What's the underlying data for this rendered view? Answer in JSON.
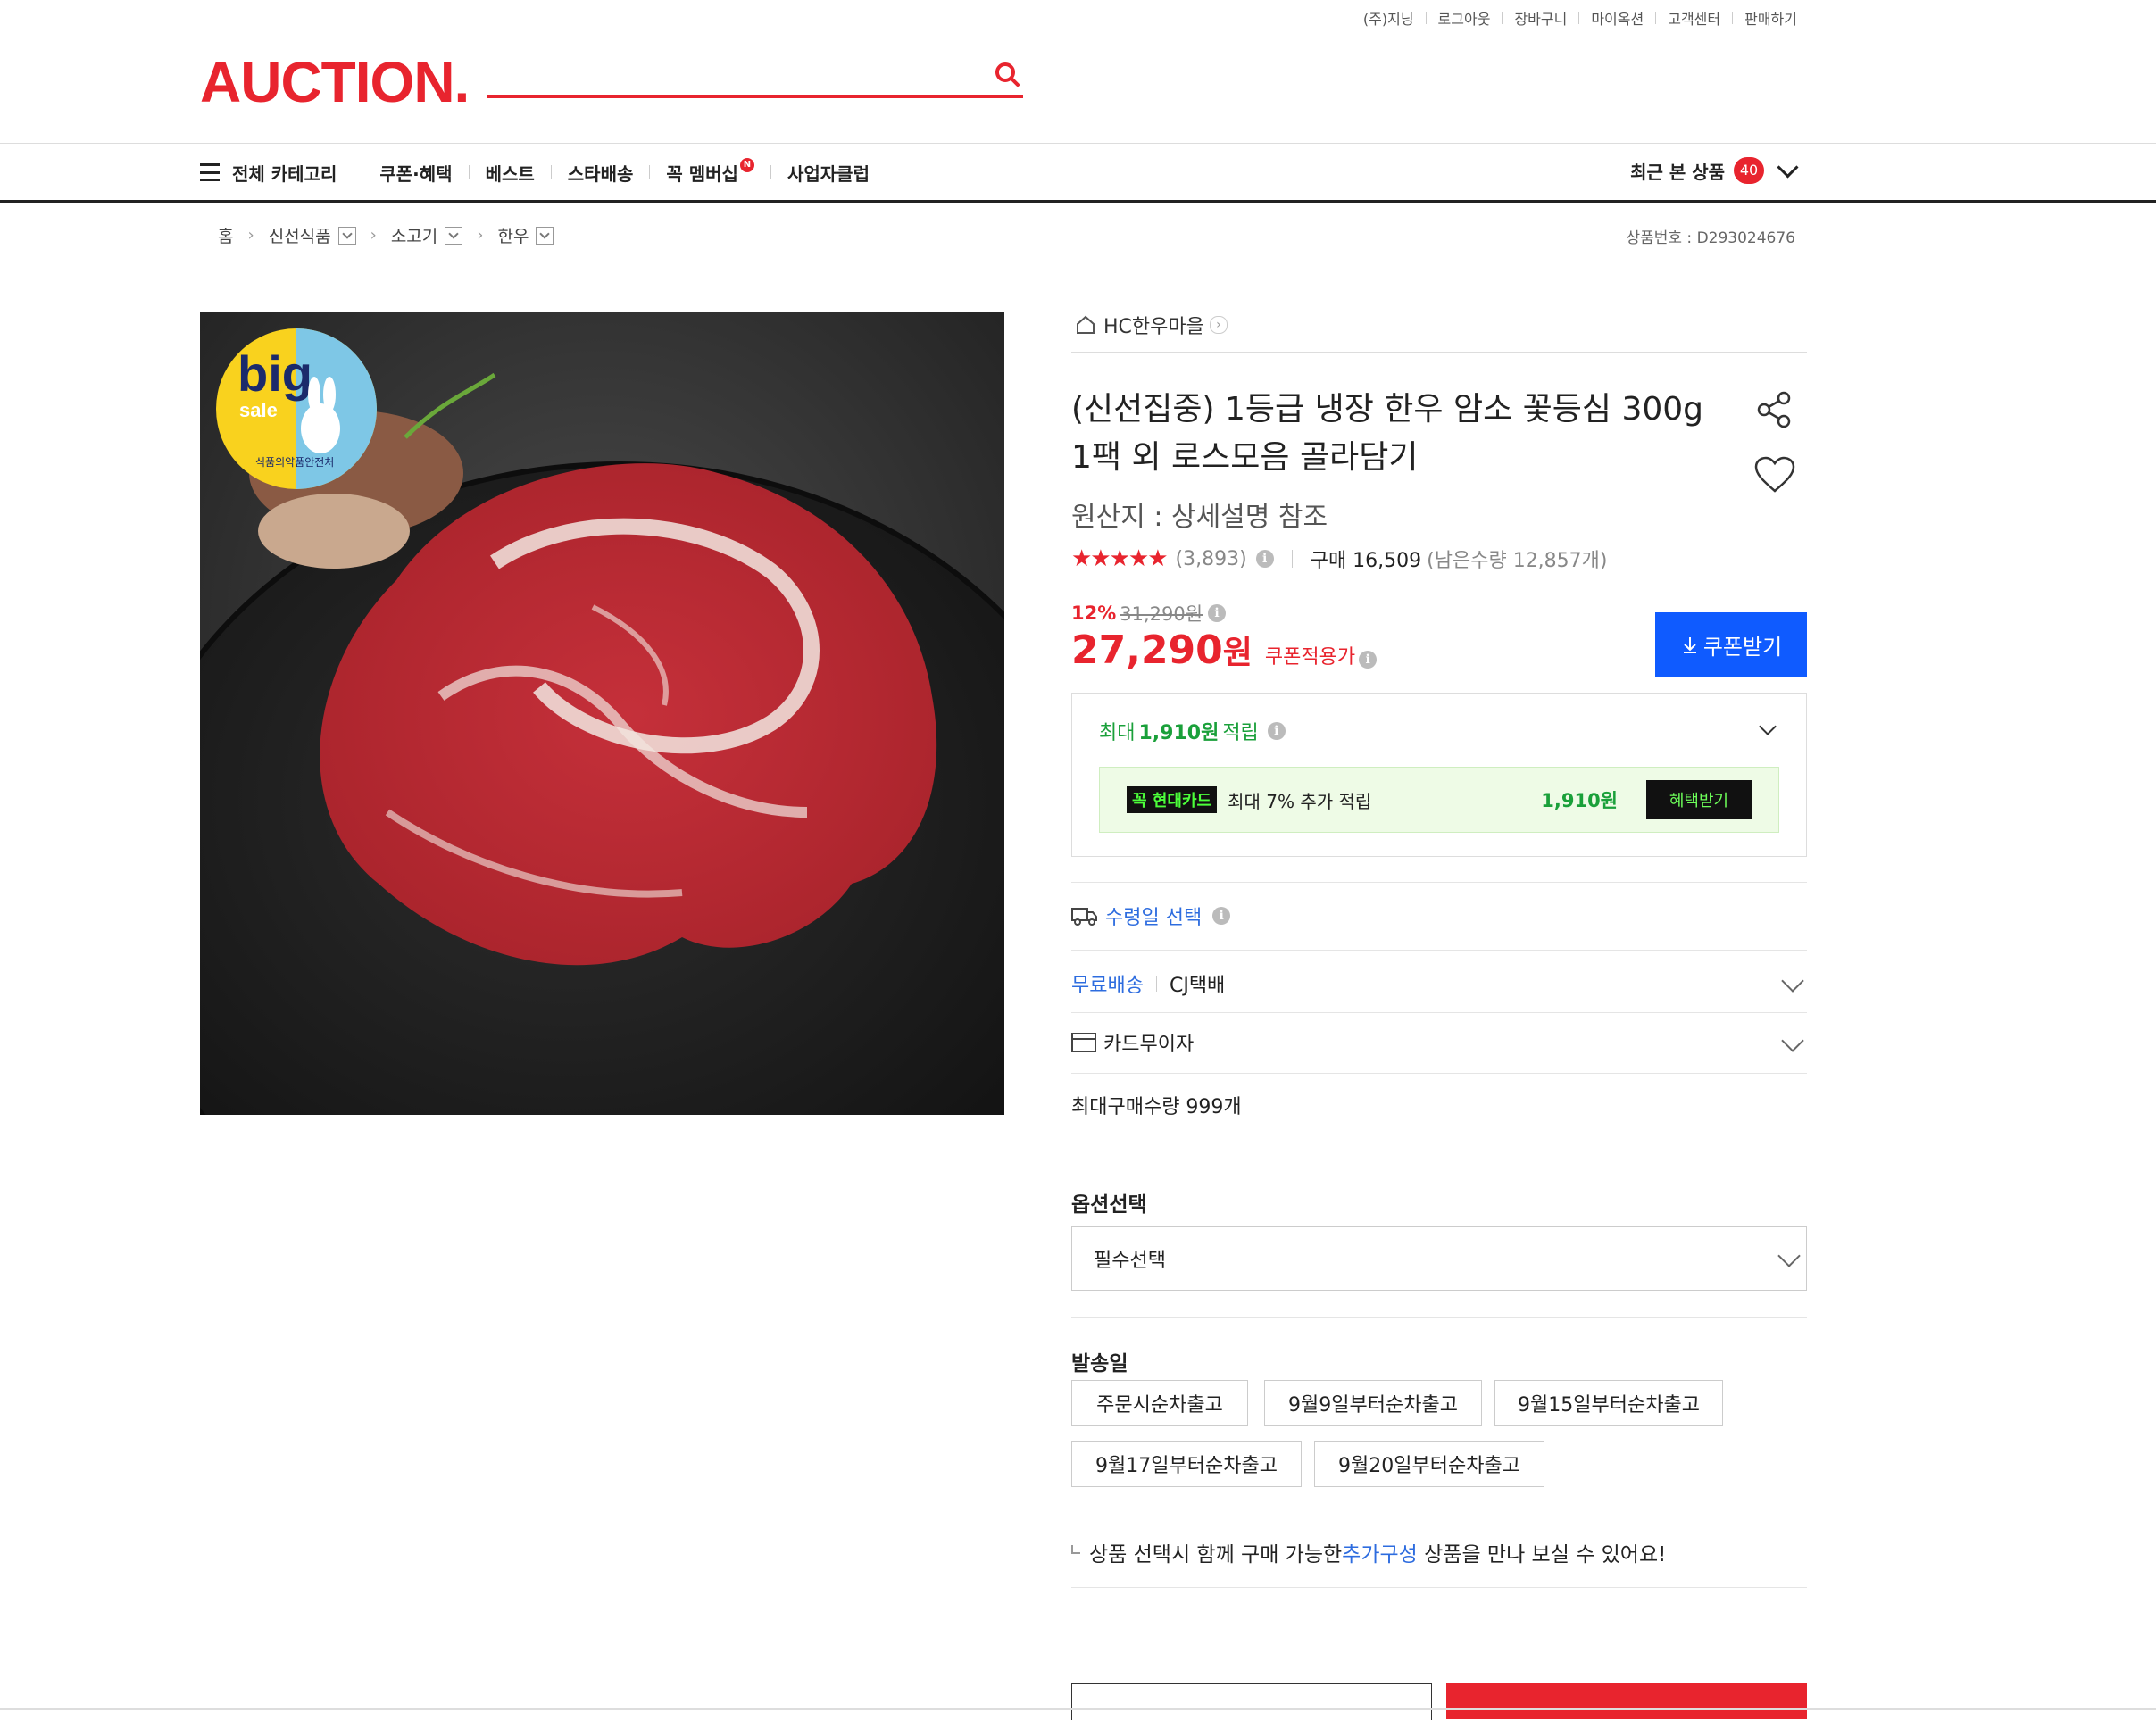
{
  "util_links": [
    "(주)지닝",
    "로그아웃",
    "장바구니",
    "마이옥션",
    "고객센터",
    "판매하기"
  ],
  "logo": "AUCTION.",
  "nav": {
    "menu": "전체 카테고리",
    "items": [
      "쿠폰·혜택",
      "베스트",
      "스타배송",
      "꼭 멤버십",
      "사업자클럽"
    ],
    "membership_badge": "N",
    "recent_label": "최근 본 상품",
    "recent_count": "40"
  },
  "breadcrumb": [
    "홈",
    "신선식품",
    "소고기",
    "한우"
  ],
  "product_no": "상품번호 : D293024676",
  "image": {
    "badge_big": "big",
    "badge_sale": "sale",
    "badge_caption": "식품의약품안전처"
  },
  "product": {
    "store": "HC한우마을",
    "title": "(신선집중) 1등급 냉장 한우 암소 꽃등심 300g 1팩 외 로스모음 골라담기",
    "origin": "원산지 : 상세설명 참조",
    "stars_display": "★★★★★",
    "rating": 4.5,
    "review_count": "(3,893)",
    "purchase": "구매 16,509",
    "remaining": "(남은수량 12,857개)",
    "discount_pct": "12%",
    "original_price": "31,290원",
    "price": "27,290",
    "price_unit": "원",
    "coupon_price_label": "쿠폰적용가",
    "coupon_btn": "쿠폰받기"
  },
  "benefit": {
    "prefix": "최대",
    "amount": "1,910원",
    "suffix": "적립",
    "card_logo": "꼭 현대카드",
    "card_text": "최대 7% 추가 적립",
    "card_amount": "1,910원",
    "card_btn": "혜택받기"
  },
  "delivery": {
    "receive_date": "수령일 선택",
    "free_shipping": "무료배송",
    "carrier": "CJ택배",
    "card_installment": "카드무이자",
    "max_qty": "최대구매수량 999개"
  },
  "options": {
    "title": "옵션선택",
    "select_value": "필수선택"
  },
  "ship_date": {
    "title": "발송일",
    "options": [
      "주문시순차출고",
      "9월9일부터순차출고",
      "9월15일부터순차출고",
      "9월17일부터순차출고",
      "9월20일부터순차출고"
    ]
  },
  "note": {
    "before": "상품 선택시 함께 구매 가능한 ",
    "link": "추가구성",
    "after": " 상품을 만나 보실 수 있어요!"
  },
  "colors": {
    "brand_red": "#e8242e",
    "coupon_blue": "#0f5bff",
    "benefit_green": "#1aa03a"
  }
}
